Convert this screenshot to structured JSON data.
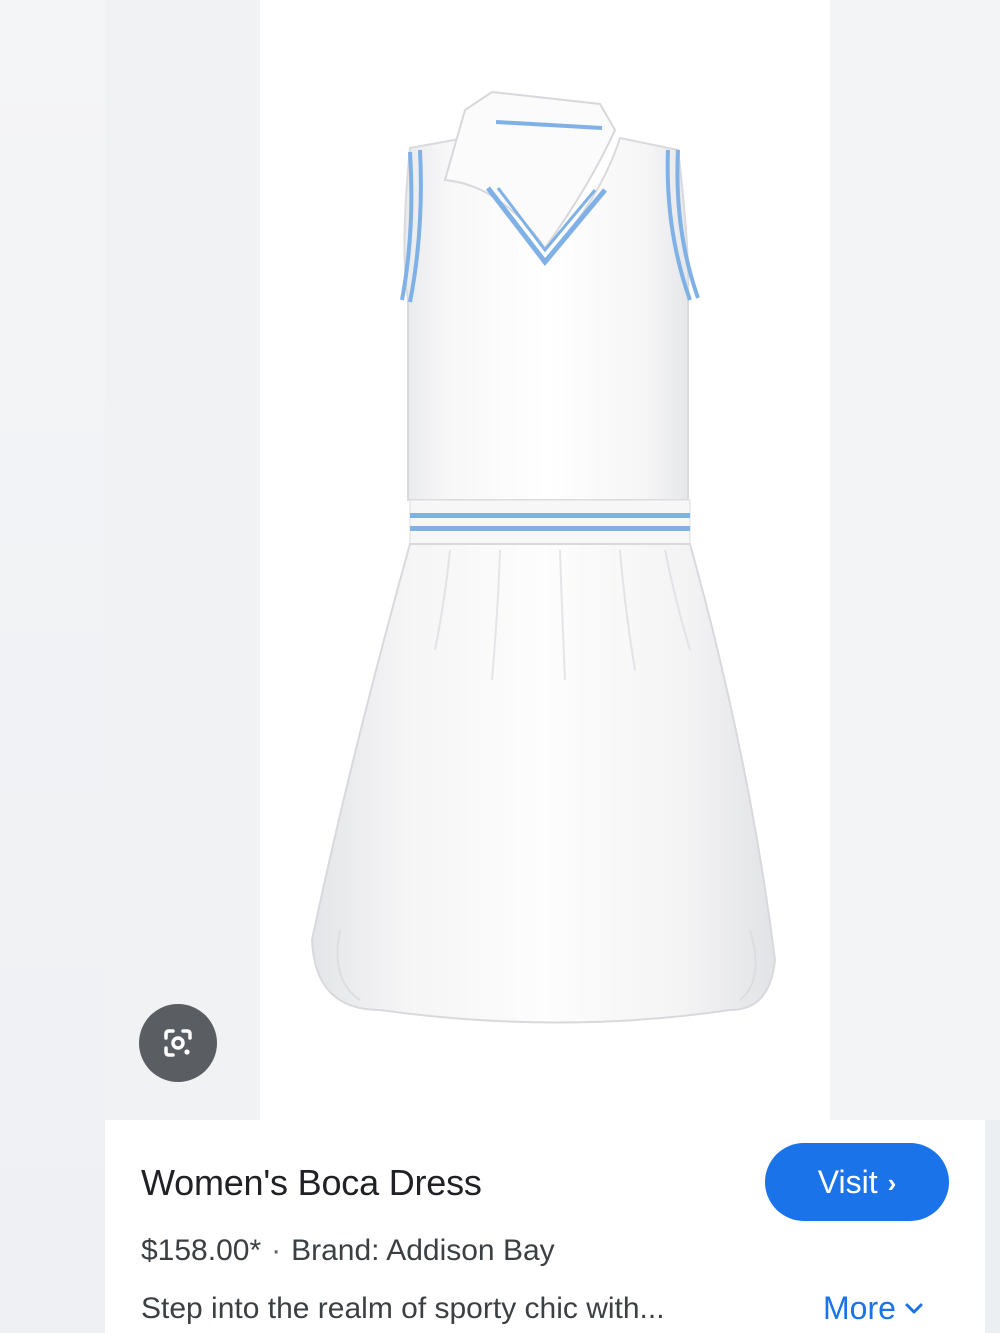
{
  "product": {
    "title": "Women's Boca Dress",
    "price": "$158.00*",
    "separator": "·",
    "brand": "Brand: Addison Bay",
    "description": "Step into the realm of sporty chic with...",
    "image_subject": "white sleeveless polo tennis dress with light-blue stripe trim"
  },
  "actions": {
    "visit_label": "Visit",
    "visit_icon": "chevron-right-icon",
    "more_label": "More",
    "more_icon": "chevron-down-icon",
    "lens_icon": "google-lens-icon"
  },
  "colors": {
    "accent": "#1a73e8",
    "stripe": "#7fb1e6",
    "lens_bg": "#5a5d61"
  }
}
